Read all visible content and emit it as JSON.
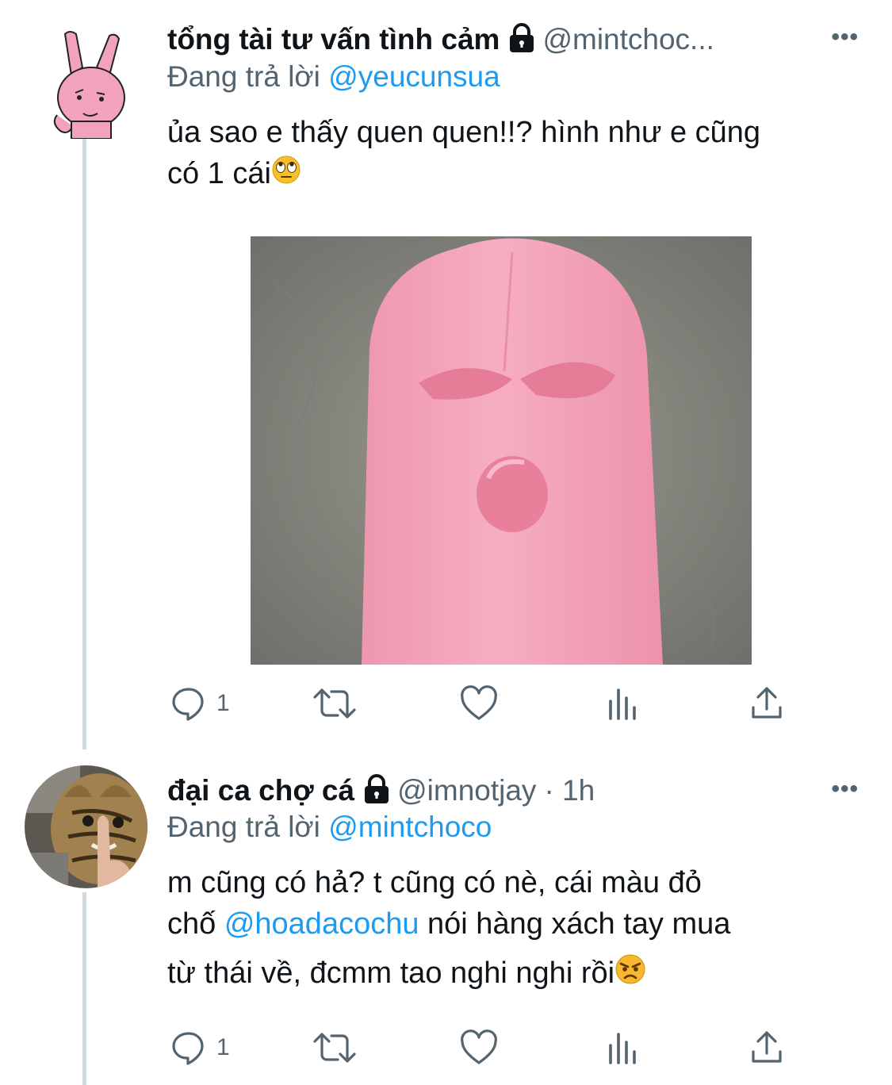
{
  "tweets": [
    {
      "author_name": "tổng tài tư vấn tình cảm",
      "handle": "@mintchoc...",
      "time": "",
      "replying_label": "Đang trả lời",
      "replying_to": "@yeucunsua",
      "text_lines": [
        "ủa sao e thấy quen quen!!? hình như e cũng",
        "có 1 cái"
      ],
      "emoji": "face-with-rolling-eyes",
      "has_image": true,
      "reply_count": "1",
      "more_label": "•••"
    },
    {
      "author_name": "đại ca chợ cá",
      "handle": "@imnotjay",
      "time": "· 1h",
      "replying_label": "Đang trả lời",
      "replying_to": "@mintchoco",
      "text_line1": "m cũng có hả? t cũng có nè, cái màu đỏ",
      "text_line2_pre": "chố ",
      "text_line2_mention": "@hoadacochu",
      "text_line2_post": " nói hàng xách tay mua",
      "text_line3": "từ thái về, đcmm tao nghi nghi rồi",
      "emoji": "angry-face",
      "reply_count": "1",
      "more_label": "•••"
    }
  ],
  "colors": {
    "accent": "#1d9bf0",
    "secondary_text": "#536471",
    "mask_pink": "#f4a7bd"
  }
}
